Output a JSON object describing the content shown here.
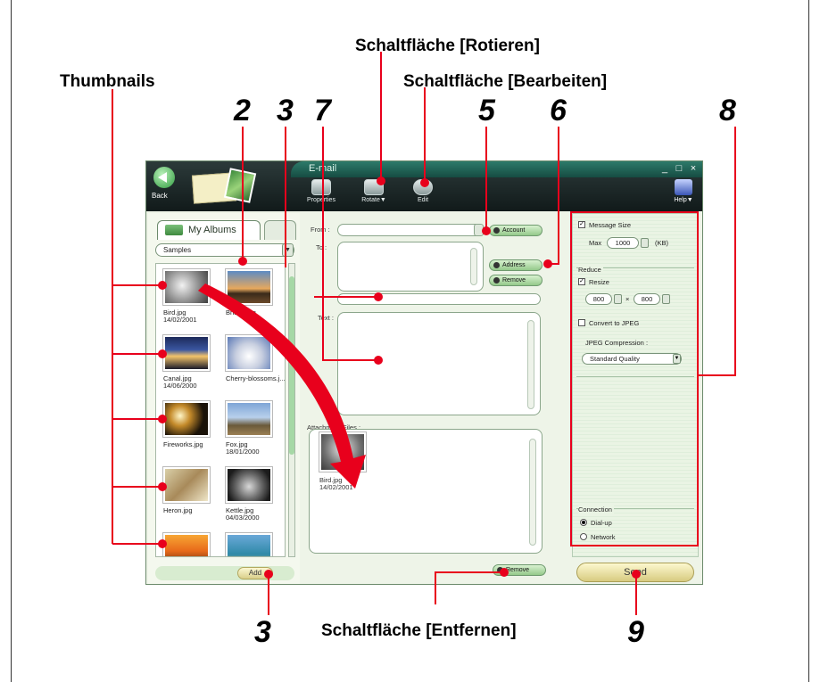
{
  "annotations": {
    "rotate_btn_label": "Schaltfläche [Rotieren]",
    "edit_btn_label": "Schaltfläche [Bearbeiten]",
    "thumbnails_label": "Thumbnails",
    "remove_btn_label": "Schaltfläche [Entfernen]",
    "numbers": [
      "2",
      "3",
      "7",
      "5",
      "6",
      "8",
      "3",
      "9"
    ]
  },
  "window": {
    "title": "E-mail",
    "back_label": "Back",
    "toolbar": [
      "Properties",
      "Rotate▼",
      "Edit"
    ],
    "help_label": "Help▼",
    "controls": [
      "_",
      "□",
      "×"
    ]
  },
  "left": {
    "tab_albums": "My Albums",
    "album_selected": "Samples",
    "thumbs": [
      {
        "name": "Bird.jpg",
        "date": "14/02/2001"
      },
      {
        "name": "Bridge.jpg",
        "date": ""
      },
      {
        "name": "Canal.jpg",
        "date": "14/06/2000"
      },
      {
        "name": "Cherry-blossoms.j...",
        "date": ""
      },
      {
        "name": "Fireworks.jpg",
        "date": ""
      },
      {
        "name": "Fox.jpg",
        "date": "18/01/2000"
      },
      {
        "name": "Heron.jpg",
        "date": ""
      },
      {
        "name": "Kettle.jpg",
        "date": "04/03/2000"
      }
    ],
    "add_label": "Add"
  },
  "middle": {
    "from_label": "From :",
    "to_label": "To :",
    "subject_label": "Subject :",
    "text_label": "Text :",
    "attachments_label": "Attachment Files :",
    "account_btn": "Account",
    "address_btn": "Address",
    "remove_to_btn": "Remove",
    "remove_att_btn": "Remove",
    "attachment": {
      "name": "Bird.jpg",
      "date": "14/02/2001"
    }
  },
  "right": {
    "message_size_label": "Message Size",
    "max_label": "Max",
    "max_value": "1000",
    "kb_label": "(KB)",
    "reduce_label": "Reduce",
    "resize_label": "Resize",
    "resize_w": "800",
    "resize_h": "800",
    "x_label": "×",
    "convert_label": "Convert to JPEG",
    "jpeg_compression_label": "JPEG Compression :",
    "jpeg_quality": "Standard Quality",
    "connection_label": "Connection",
    "dialup_label": "Dial-up",
    "network_label": "Network"
  },
  "send_label": "Send"
}
